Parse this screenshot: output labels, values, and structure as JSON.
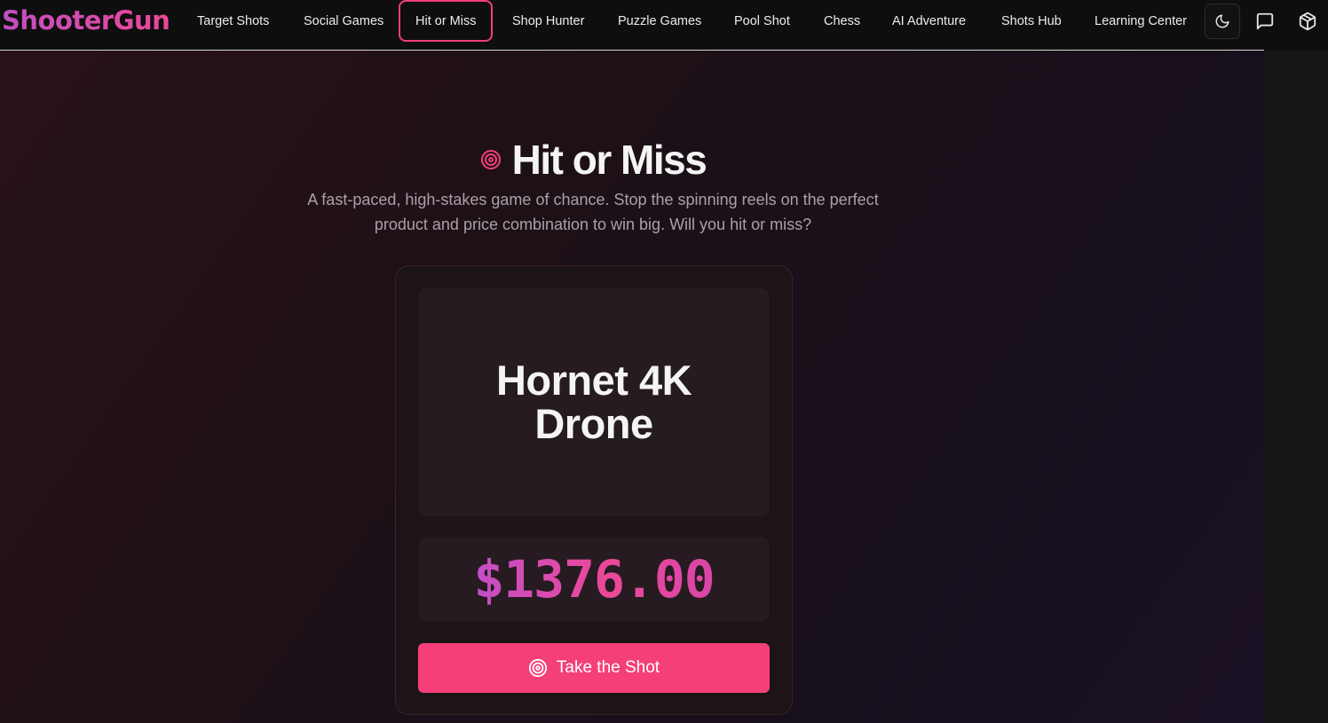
{
  "header": {
    "logo": "ShooterGun",
    "nav": [
      {
        "label": "Target Shots"
      },
      {
        "label": "Social Games"
      },
      {
        "label": "Hit or Miss",
        "active": true
      },
      {
        "label": "Shop Hunter"
      },
      {
        "label": "Puzzle Games"
      },
      {
        "label": "Pool Shot"
      },
      {
        "label": "Chess"
      },
      {
        "label": "AI Adventure"
      },
      {
        "label": "Shots Hub"
      },
      {
        "label": "Learning Center"
      }
    ],
    "icons": [
      "moon-icon",
      "chat-icon",
      "cube-icon"
    ]
  },
  "hero": {
    "icon": "target-icon",
    "title": "Hit or Miss",
    "subtitle": "A fast-paced, high-stakes game of chance. Stop the spinning reels on the perfect product and price combination to win big. Will you hit or miss?"
  },
  "game": {
    "product_name": "Hornet 4K Drone",
    "price": "$1376.00",
    "button_label": "Take the Shot",
    "button_icon": "target-icon"
  },
  "colors": {
    "accent": "#f43f78",
    "brand_gradient_start": "#c04fc0",
    "brand_gradient_end": "#ec4899",
    "background": "#1d1017",
    "card": "#1c1417",
    "panel": "#261b20"
  }
}
